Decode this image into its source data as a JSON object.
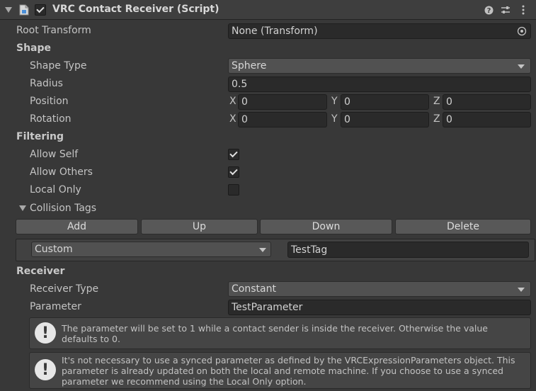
{
  "header": {
    "title": "VRC Contact Receiver (Script)",
    "enabled": true
  },
  "fields": {
    "root_transform_label": "Root Transform",
    "root_transform_value": "None (Transform)",
    "shape_section": "Shape",
    "shape_type_label": "Shape Type",
    "shape_type_value": "Sphere",
    "radius_label": "Radius",
    "radius_value": "0.5",
    "position_label": "Position",
    "position": {
      "x": "0",
      "y": "0",
      "z": "0"
    },
    "rotation_label": "Rotation",
    "rotation": {
      "x": "0",
      "y": "0",
      "z": "0"
    },
    "axis_labels": {
      "x": "X",
      "y": "Y",
      "z": "Z"
    }
  },
  "filtering": {
    "section": "Filtering",
    "allow_self_label": "Allow Self",
    "allow_self": true,
    "allow_others_label": "Allow Others",
    "allow_others": true,
    "local_only_label": "Local Only",
    "local_only": false,
    "collision_tags_label": "Collision Tags",
    "buttons": {
      "add": "Add",
      "up": "Up",
      "down": "Down",
      "delete": "Delete"
    },
    "tag_item": {
      "type": "Custom",
      "value": "TestTag"
    }
  },
  "receiver": {
    "section": "Receiver",
    "receiver_type_label": "Receiver Type",
    "receiver_type_value": "Constant",
    "parameter_label": "Parameter",
    "parameter_value": "TestParameter",
    "help1": "The parameter will be set to 1 while a contact sender is inside the receiver.  Otherwise the value defaults to 0.",
    "help2": "It's not necessary to use a synced parameter as defined by the VRCExpressionParameters object.  This parameter is already updated on both the local and remote machine.  If you choose to use a synced parameter we recommend using the Local Only option."
  }
}
